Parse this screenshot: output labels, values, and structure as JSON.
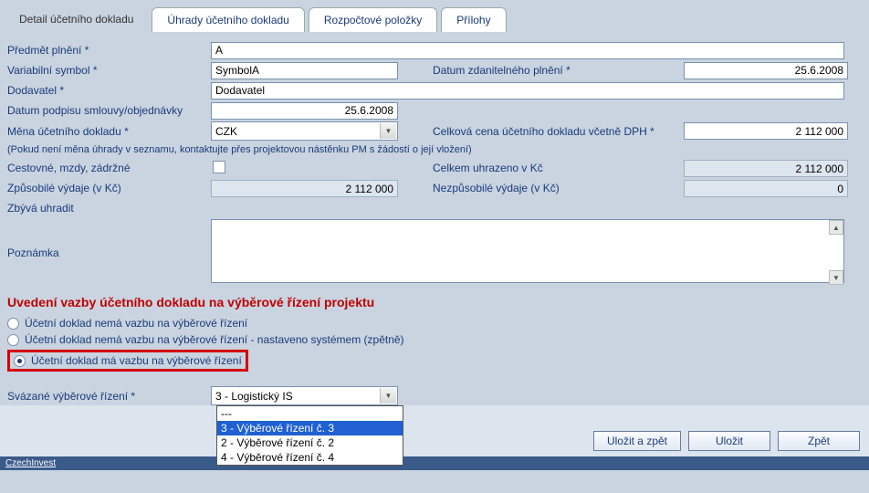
{
  "tabs": {
    "t0": "Detail účetního dokladu",
    "t1": "Úhrady účetního dokladu",
    "t2": "Rozpočtové položky",
    "t3": "Přílohy"
  },
  "labels": {
    "predmet": "Předmět plnění *",
    "varsym": "Variabilní symbol *",
    "datum_zdan": "Datum zdanitelného plnění *",
    "dodavatel": "Dodavatel *",
    "datum_podpisu": "Datum podpisu smlouvy/objednávky",
    "mena": "Měna účetního dokladu *",
    "celkova_cena": "Celková cena účetního dokladu včetně DPH *",
    "mena_note": "(Pokud není měna úhrady v seznamu, kontaktujte přes projektovou nástěnku PM s žádostí o její vložení)",
    "cestovne": "Cestovné, mzdy, zádržné",
    "celkem_uhr": "Celkem uhrazeno v Kč",
    "zpusobile": "Způsobilé výdaje (v Kč)",
    "nezpusobile": "Nezpůsobilé výdaje (v Kč)",
    "zbyva": "Zbývá uhradit",
    "poznamka": "Poznámka",
    "svazane": "Svázané výběrové řízení *"
  },
  "values": {
    "predmet": "A",
    "varsym": "SymbolA",
    "datum_zdan": "25.6.2008",
    "dodavatel": "Dodavatel",
    "datum_podpisu": "25.6.2008",
    "mena": "CZK",
    "celkova_cena": "2 112 000",
    "celkem_uhr": "2 112 000",
    "zpusobile": "2 112 000",
    "nezpusobile": "0",
    "svazane_selected": "3 - Logistický IS"
  },
  "section_heading": "Uvedení vazby účetního dokladu na výběrové řízení projektu",
  "radios": {
    "r0": "Účetní doklad nemá vazbu na výběrové řízení",
    "r1": "Účetní doklad nemá vazbu na výběrové řízení - nastaveno systémem (zpětně)",
    "r2": "Účetní doklad má vazbu na výběrové řízení"
  },
  "dropdown_items": {
    "d0": "---",
    "d1": "3 - Výběrové řízení č. 3",
    "d2": "2 - Výběrové řízení č. 2",
    "d3": "4 - Výběrové řízení č. 4"
  },
  "buttons": {
    "save_back": "Uložit a zpět",
    "save": "Uložit",
    "back": "Zpět"
  },
  "footer": "CzechInvest"
}
